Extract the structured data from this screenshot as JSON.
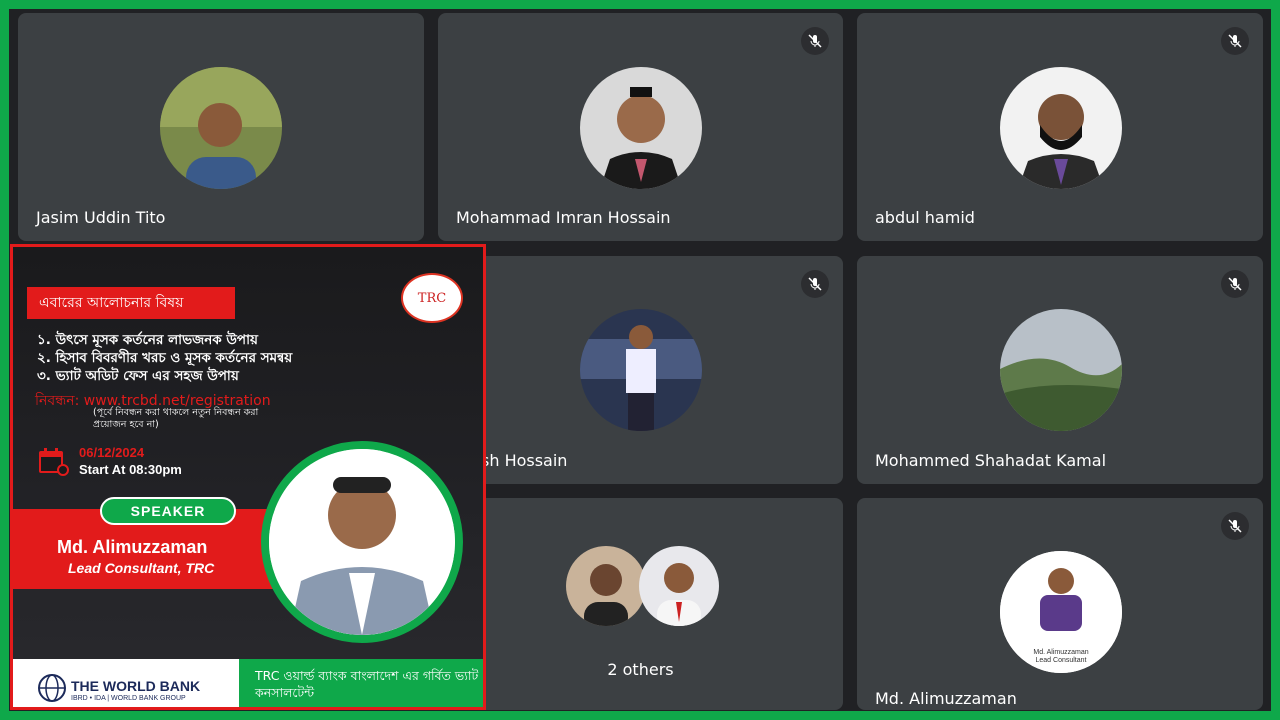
{
  "participants": [
    {
      "name": "Jasim Uddin Tito",
      "muted": false
    },
    {
      "name": "Mohammad Imran Hossain",
      "muted": true
    },
    {
      "name": "abdul hamid",
      "muted": true
    },
    {
      "name": "sh Hossain",
      "muted": true
    },
    {
      "name": "Mohammed Shahadat Kamal",
      "muted": true
    },
    {
      "name": "Md. Alimuzzaman",
      "muted": true
    }
  ],
  "others_label": "2 others",
  "avatar_caption": {
    "name": "Md. Alimuzzaman",
    "role": "Lead Consultant"
  },
  "poster": {
    "topic_header": "এবারের আলোচনার বিষয়",
    "logo_text": "TRC",
    "topics": [
      "১. উৎসে মূসক কর্তনের লাভজনক উপায়",
      "২. হিসাব বিবরণীর খরচ ও মূসক কর্তনের সমন্বয়",
      "৩. ভ্যাট অডিট ফেস এর সহজ উপায়"
    ],
    "registration": "নিবন্ধন: www.trcbd.net/registration",
    "registration_note": "(পূর্বে নিবন্ধন করা থাকলে নতুন নিবন্ধন করা প্রয়োজন হবে না)",
    "date": "06/12/2024",
    "start": "Start At 08:30pm",
    "speaker_label": "SPEAKER",
    "speaker_name": "Md. Alimuzzaman",
    "speaker_title": "Lead Consultant, TRC",
    "world_bank": "THE WORLD BANK",
    "world_bank_sub": "IBRD • IDA | WORLD BANK GROUP",
    "footer_text": "TRC ওয়ার্ল্ড ব্যাংক বাংলাদেশ এর গর্বিত ভ্যাট কনসালটেন্ট"
  },
  "colors": {
    "frame": "#0fa84a",
    "tile": "#3c4043",
    "accent_red": "#e21b1b"
  }
}
